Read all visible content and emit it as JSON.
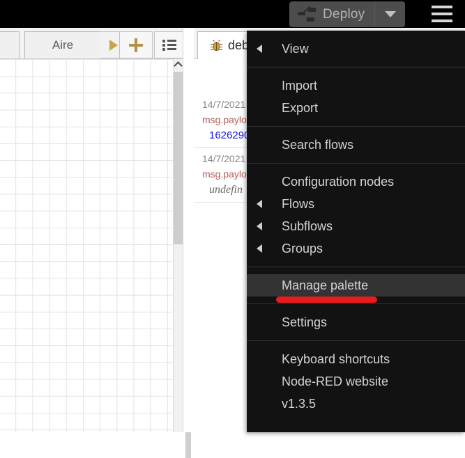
{
  "header": {
    "deploy_label": "Deploy",
    "deploy_icon": "flow-nodes-icon",
    "deploy_caret_icon": "chevron-down-icon",
    "main_menu_icon": "hamburger-menu-icon",
    "background_color": "#000000",
    "deploy_button_color": "#4d4d4d"
  },
  "flow_editor": {
    "tabs": [
      {
        "label": "",
        "name": "flow-tab-partial"
      },
      {
        "label": "Aire",
        "name": "flow-tab-aire"
      }
    ],
    "tools": [
      {
        "name": "tab-scroll-right-button",
        "icon": "triangle-right-icon"
      },
      {
        "name": "add-flow-button",
        "icon": "plus-icon"
      },
      {
        "name": "list-flows-button",
        "icon": "list-icon"
      }
    ],
    "scrollbar": {
      "up_arrow_icon": "chevron-up-icon"
    }
  },
  "sidebar": {
    "tab_label": "debu",
    "tab_icon": "bug-icon",
    "messages": [
      {
        "timestamp": "14/7/2021",
        "topic": "msg.paylo",
        "value": "1626290",
        "value_type": "number"
      },
      {
        "timestamp": "14/7/2021",
        "topic": "msg.payloa",
        "value": "undefin",
        "value_type": "undefined"
      }
    ]
  },
  "main_menu": {
    "background_color": "#121212",
    "highlight_color": "#333333",
    "sections": [
      {
        "items": [
          {
            "label": "View",
            "submenu": true,
            "submenu_icon": "triangle-left-icon",
            "highlight": false
          }
        ]
      },
      {
        "items": [
          {
            "label": "Import",
            "submenu": false,
            "highlight": false
          },
          {
            "label": "Export",
            "submenu": false,
            "highlight": false
          }
        ]
      },
      {
        "items": [
          {
            "label": "Search flows",
            "submenu": false,
            "highlight": false
          }
        ]
      },
      {
        "items": [
          {
            "label": "Configuration nodes",
            "submenu": false,
            "highlight": false
          },
          {
            "label": "Flows",
            "submenu": true,
            "submenu_icon": "triangle-left-icon",
            "highlight": false
          },
          {
            "label": "Subflows",
            "submenu": true,
            "submenu_icon": "triangle-left-icon",
            "highlight": false
          },
          {
            "label": "Groups",
            "submenu": true,
            "submenu_icon": "triangle-left-icon",
            "highlight": false
          }
        ]
      },
      {
        "items": [
          {
            "label": "Manage palette",
            "submenu": false,
            "highlight": true
          }
        ]
      },
      {
        "items": [
          {
            "label": "Settings",
            "submenu": false,
            "highlight": false
          }
        ]
      },
      {
        "items": [
          {
            "label": "Keyboard shortcuts",
            "submenu": false,
            "highlight": false
          },
          {
            "label": "Node-RED website",
            "submenu": false,
            "highlight": false
          },
          {
            "label": "v1.3.5",
            "submenu": false,
            "highlight": false
          }
        ]
      }
    ]
  },
  "annotation": {
    "color": "#e81c1c",
    "target": "Manage palette"
  }
}
